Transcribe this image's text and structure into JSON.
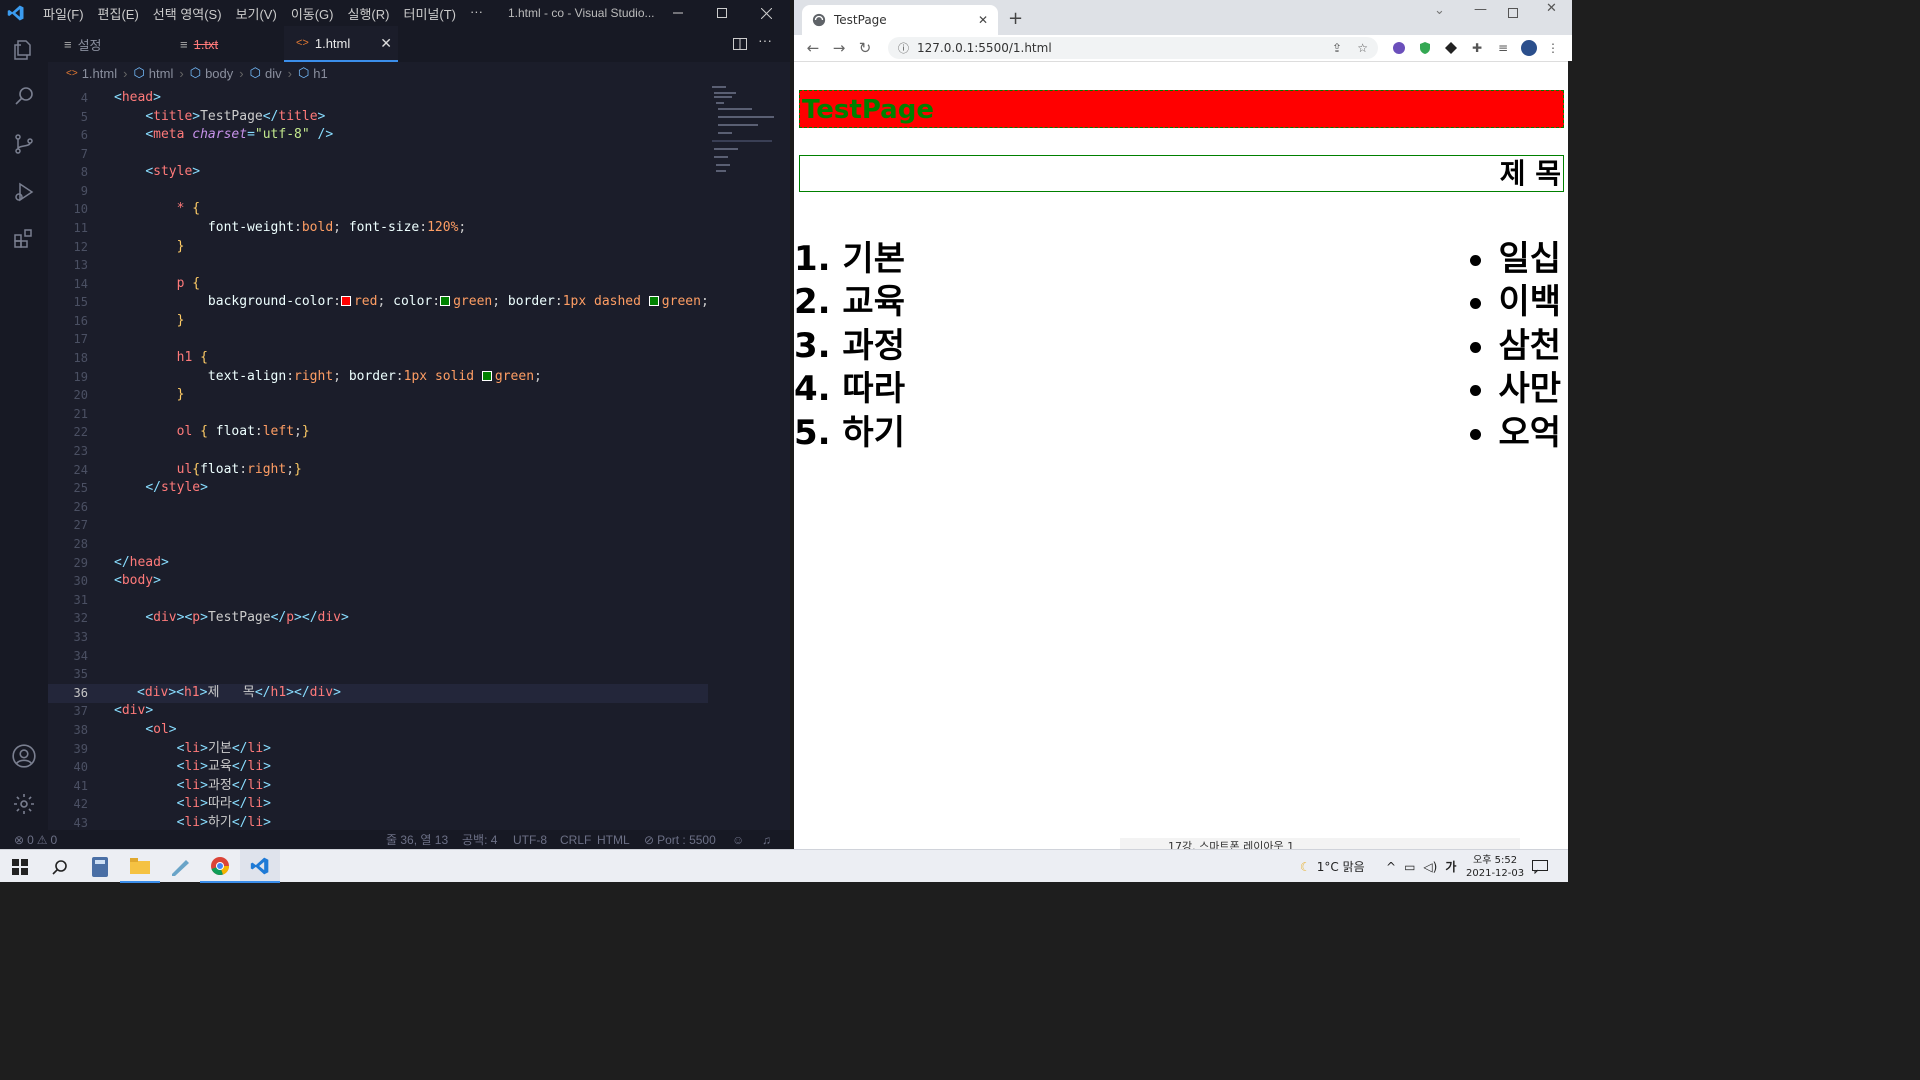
{
  "vscode": {
    "menu": [
      "파일(F)",
      "편집(E)",
      "선택 영역(S)",
      "보기(V)",
      "이동(G)",
      "실행(R)",
      "터미널(T)",
      "···"
    ],
    "window_title": "1.html - co - Visual Studio...",
    "tabs": [
      {
        "label": "설정",
        "icon": "settings-file-icon"
      },
      {
        "label": "1.txt",
        "icon": "text-file-icon"
      },
      {
        "label": "1.html",
        "icon": "html-file-icon"
      }
    ],
    "breadcrumb": [
      "1.html",
      "html",
      "body",
      "div",
      "h1"
    ],
    "status": {
      "errors": "0",
      "warnings": "0",
      "position": "줄 36, 열 13",
      "spaces": "공백: 4",
      "encoding": "UTF-8",
      "eol": "CRLF",
      "language": "HTML",
      "port": "Port : 5500"
    },
    "code_colors": {
      "red": "#ff0000",
      "green": "#008000"
    }
  },
  "browser": {
    "tab_title": "TestPage",
    "url": "127.0.0.1:5500/1.html",
    "page": {
      "p_text": "TestPage",
      "h1_text": "제 목",
      "ol_items": [
        "기본",
        "교육",
        "과정",
        "따라",
        "하기"
      ],
      "ol_numbers": [
        "1.",
        "2.",
        "3.",
        "4.",
        "5."
      ],
      "ul_items": [
        "일십",
        "이백",
        "삼천",
        "사만",
        "오억"
      ]
    }
  },
  "peek_text": "17강. 스마트폰 레이아웃 1",
  "taskbar": {
    "weather": "1°C  맑음",
    "ime": "가",
    "time": "오후 5:52",
    "date": "2021-12-03"
  }
}
